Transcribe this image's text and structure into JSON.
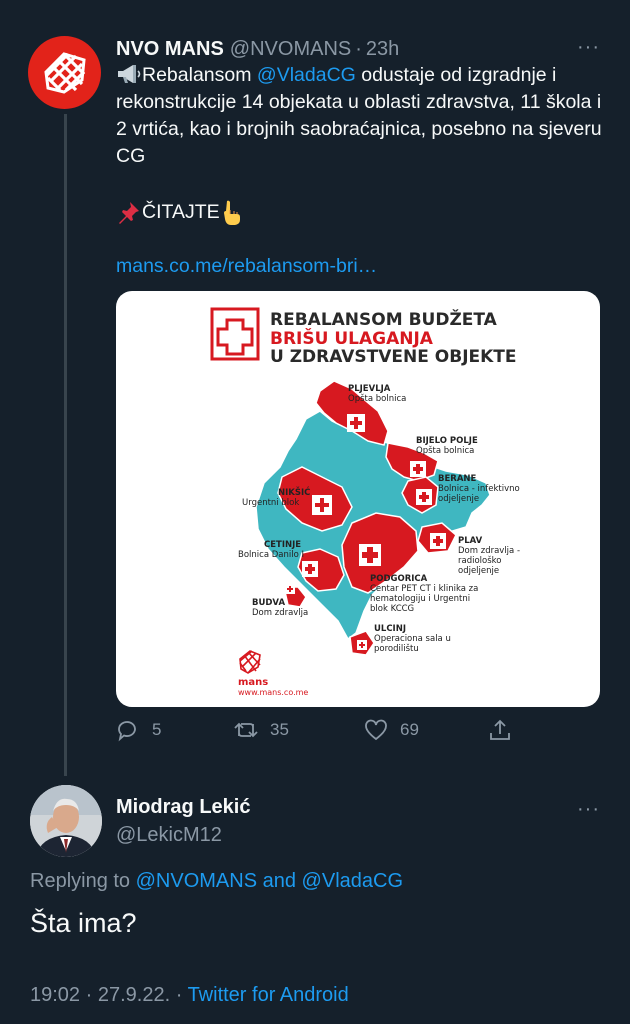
{
  "tweet": {
    "author_name": "NVO MANS",
    "author_handle": "@NVOMANS",
    "separator": "·",
    "time": "23h",
    "more": "···",
    "text_pre": "Rebalansom",
    "mention": "@VladaCG",
    "text_post": " odustaje od izgradnje i rekonstrukcije 14 objekata u oblasti zdravstva, 11 škola i 2 vrtića, kao i brojnih saobraćajnica, posebno na sjeveru CG",
    "cta": "ČITAJTE",
    "link": "mans.co.me/rebalansom-bri…",
    "actions": {
      "replies": "5",
      "retweets": "35",
      "likes": "69"
    },
    "icons": [
      "megaphone-icon",
      "pushpin-icon",
      "pointing-down-icon",
      "reply-icon",
      "retweet-icon",
      "like-icon",
      "share-icon"
    ]
  },
  "card": {
    "title_line1": "REBALANSOM BUDŽETA",
    "title_line2": "BRIŠU ULAGANJA",
    "title_line3": "U ZDRAVSTVENE OBJEKTE",
    "labels": {
      "pljevlja_1": "PLJEVLJA",
      "pljevlja_2": "Opšta bolnica",
      "bijelo_1": "BIJELO POLJE",
      "bijelo_2": "Opšta bolnica",
      "berane_1": "BERANE",
      "berane_2": "Bolnica - infektivno",
      "berane_3": "odjeljenje",
      "niksic_1": "NIKŠIĆ",
      "niksic_2": "Urgentni blok",
      "plav_1": "PLAV",
      "plav_2": "Dom zdravlja -",
      "plav_3": "radiološko",
      "plav_4": "odjeljenje",
      "cetinje_1": "CETINJE",
      "cetinje_2": "Bolnica Danilo I",
      "podgorica_1": "PODGORICA",
      "podgorica_2": "Centar PET CT i klinika za",
      "podgorica_3": "hematologiju i Urgentni",
      "podgorica_4": "blok KCCG",
      "budva_1": "BUDVA",
      "budva_2": "Dom zdravlja",
      "ulcinj_1": "ULCINJ",
      "ulcinj_2": "Operaciona sala u",
      "ulcinj_3": "porodilištu"
    },
    "logo_text": "mans",
    "logo_url": "www.mans.co.me",
    "colors": {
      "red": "#d71920",
      "teal": "#3fb7c1"
    }
  },
  "reply": {
    "author_name": "Miodrag Lekić",
    "author_handle": "@LekicM12",
    "more": "···",
    "replying_prefix": "Replying to ",
    "replying_to_1": "@NVOMANS",
    "replying_and": " and ",
    "replying_to_2": "@VladaCG",
    "text": "Šta ima?",
    "time": "19:02",
    "date": "27.9.22.",
    "source": "Twitter for Android"
  }
}
